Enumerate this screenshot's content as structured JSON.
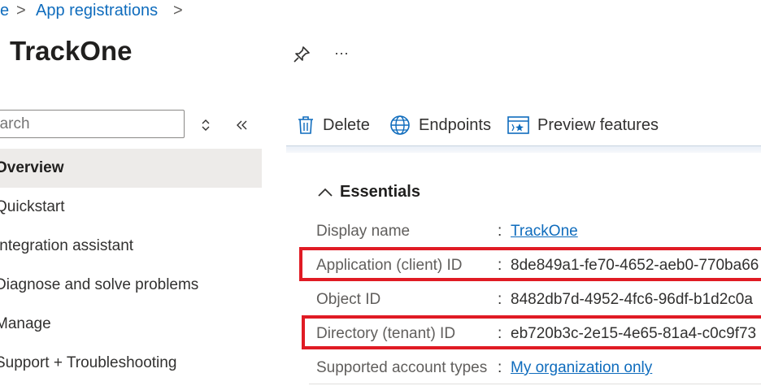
{
  "breadcrumb": {
    "home_fragment": "e",
    "separator": ">",
    "item": "App registrations"
  },
  "page": {
    "title": "TrackOne",
    "more_label": "···"
  },
  "sidebar": {
    "search_placeholder": "earch",
    "items": [
      {
        "label": "Overview"
      },
      {
        "label": "Quickstart"
      },
      {
        "label": "Integration assistant"
      },
      {
        "label": "Diagnose and solve problems"
      },
      {
        "label": "Manage"
      },
      {
        "label": "Support + Troubleshooting"
      }
    ]
  },
  "toolbar": {
    "delete_label": "Delete",
    "endpoints_label": "Endpoints",
    "preview_label": "Preview features"
  },
  "essentials": {
    "heading": "Essentials",
    "rows": [
      {
        "label": "Display name",
        "value": "TrackOne "
      },
      {
        "label": "Application (client) ID",
        "value": "8de849a1-fe70-4652-aeb0-770ba66"
      },
      {
        "label": "Object ID",
        "value": "8482db7d-4952-4fc6-96df-b1d2c0a"
      },
      {
        "label": "Directory (tenant) ID",
        "value": "eb720b3c-2e15-4e65-81a4-c0c9f73"
      },
      {
        "label": "Supported account types",
        "value": "My organization only"
      }
    ],
    "colon": ":"
  },
  "colors": {
    "link": "#0f6cbd",
    "highlight": "#e01b24",
    "selected_bg": "#edebe9"
  }
}
